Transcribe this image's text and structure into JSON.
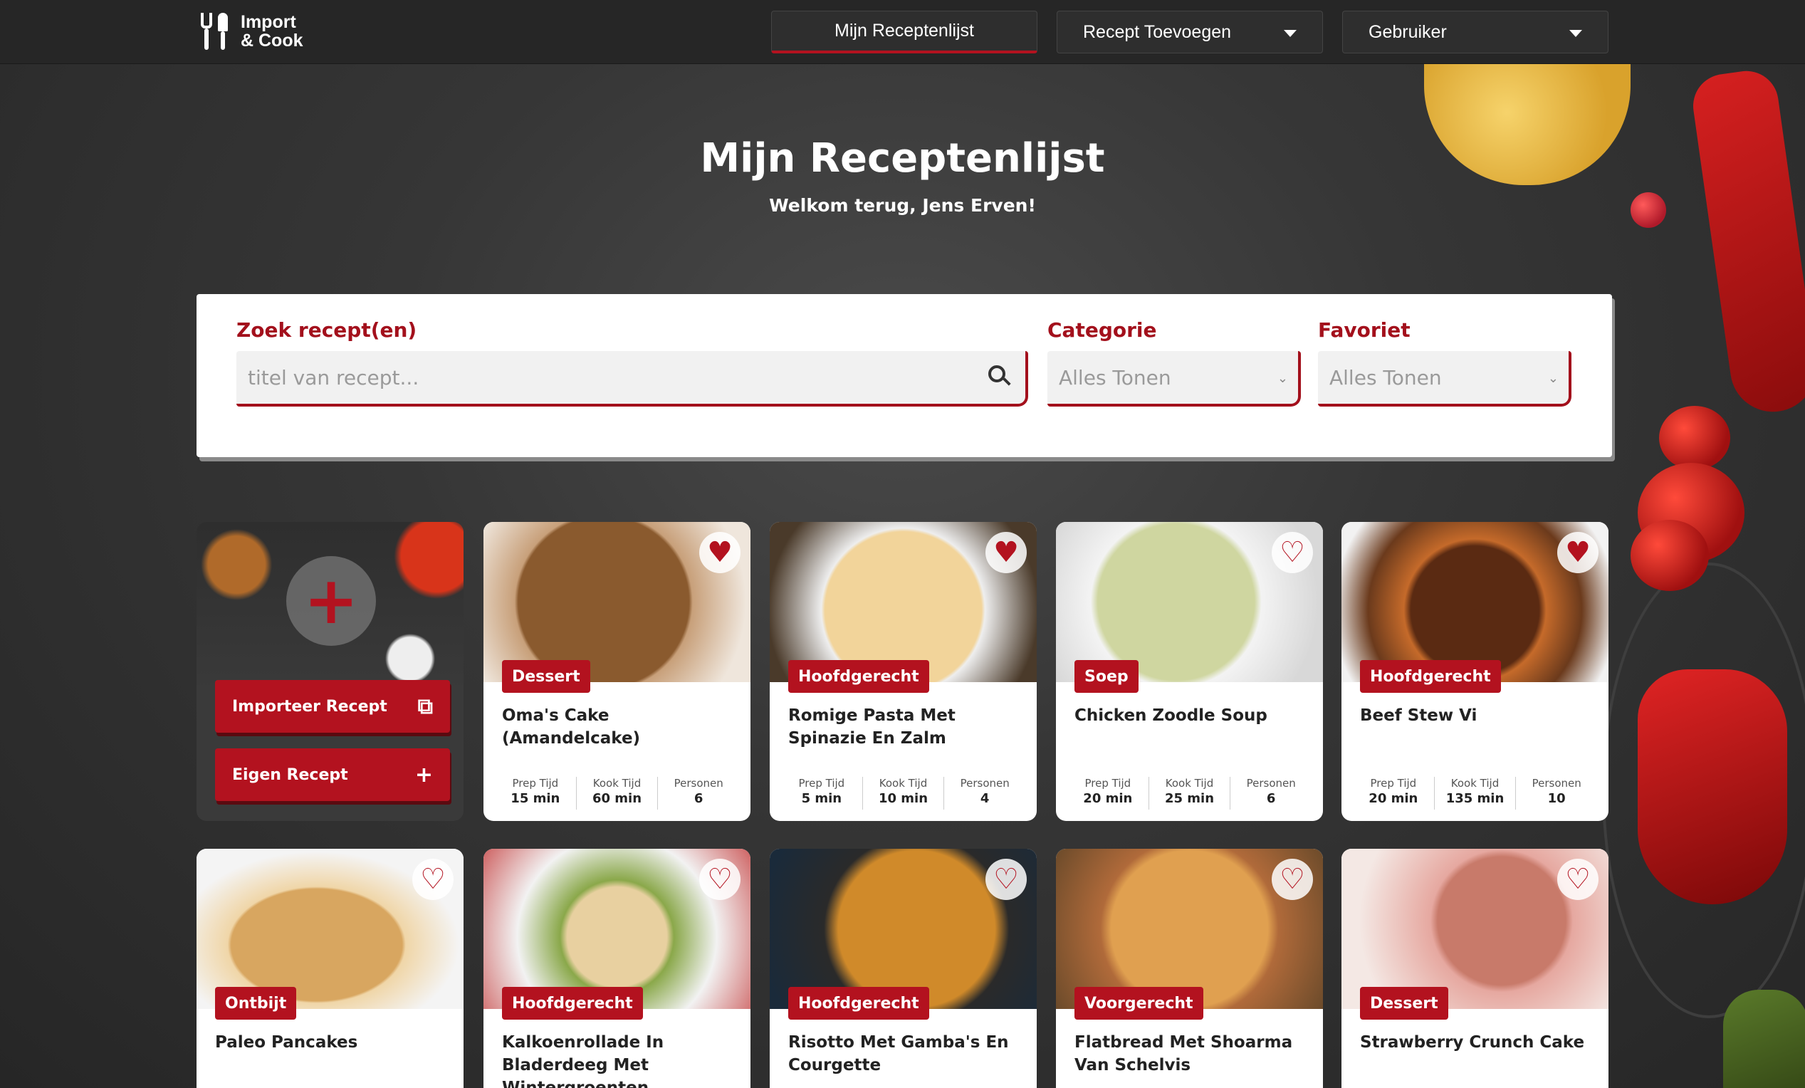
{
  "colors": {
    "accent": "#b3121f",
    "header_bg": "#262626",
    "panel_bg": "#ffffff"
  },
  "header": {
    "logo_line1": "Import",
    "logo_line2": "& Cook",
    "nav": {
      "my_list": "Mijn Receptenlijst",
      "add_recipe": "Recept Toevoegen",
      "user": "Gebruiker"
    }
  },
  "hero": {
    "title": "Mijn Receptenlijst",
    "subtitle": "Welkom terug, Jens Erven!"
  },
  "filters": {
    "search_label": "Zoek recept(en)",
    "search_placeholder": "titel van recept...",
    "category_label": "Categorie",
    "category_value": "Alles Tonen",
    "favorite_label": "Favoriet",
    "favorite_value": "Alles Tonen"
  },
  "add_card": {
    "import_label": "Importeer Recept",
    "own_label": "Eigen Recept"
  },
  "stat_labels": {
    "prep": "Prep Tijd",
    "cook": "Kook Tijd",
    "persons": "Personen"
  },
  "recipes": [
    {
      "title": "Oma's Cake (Amandelcake)",
      "category": "Dessert",
      "prep": "15 min",
      "cook": "60 min",
      "persons": "6",
      "favorite": true,
      "image_icon": "almond-cake"
    },
    {
      "title": "Romige Pasta Met Spinazie En Zalm",
      "category": "Hoofdgerecht",
      "prep": "5 min",
      "cook": "10 min",
      "persons": "4",
      "favorite": true,
      "image_icon": "salmon-pasta"
    },
    {
      "title": "Chicken Zoodle Soup",
      "category": "Soep",
      "prep": "20 min",
      "cook": "25 min",
      "persons": "6",
      "favorite": false,
      "image_icon": "soup-bowl"
    },
    {
      "title": "Beef Stew Vi",
      "category": "Hoofdgerecht",
      "prep": "20 min",
      "cook": "135 min",
      "persons": "10",
      "favorite": true,
      "image_icon": "beef-stew"
    },
    {
      "title": "Paleo Pancakes",
      "category": "Ontbijt",
      "favorite": false,
      "image_icon": "pancakes"
    },
    {
      "title": "Kalkoenrollade In Bladerdeeg Met Wintergroenten, Pepersaus En Kroketten.",
      "category": "Hoofdgerecht",
      "favorite": false,
      "image_icon": "turkey-roll"
    },
    {
      "title": "Risotto Met Gamba's En Courgette",
      "category": "Hoofdgerecht",
      "favorite": false,
      "image_icon": "risotto-pan"
    },
    {
      "title": "Flatbread Met Shoarma Van Schelvis",
      "category": "Voorgerecht",
      "favorite": false,
      "image_icon": "flatbread"
    },
    {
      "title": "Strawberry Crunch Cake",
      "category": "Dessert",
      "favorite": false,
      "image_icon": "layer-cake"
    }
  ]
}
